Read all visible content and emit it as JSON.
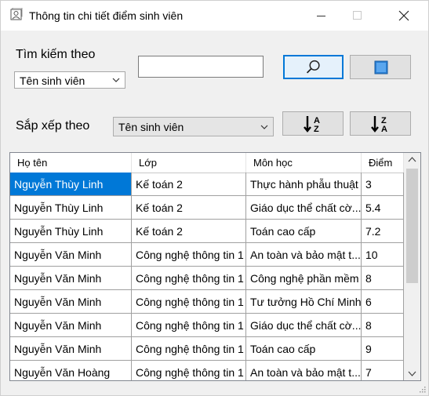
{
  "window": {
    "title": "Thông tin chi tiết điểm sinh viên",
    "icon": "student-info-icon"
  },
  "search": {
    "label": "Tìm kiếm theo",
    "field_selected": "Tên sinh viên",
    "query_value": "",
    "search_icon": "search-icon",
    "refresh_icon": "refresh-icon"
  },
  "sort": {
    "label": "Sắp xếp theo",
    "field_selected": "Tên sinh viên",
    "asc_icon": "sort-ascending-icon",
    "desc_icon": "sort-descending-icon"
  },
  "table": {
    "columns": [
      "Họ tên",
      "Lớp",
      "Môn học",
      "Điểm"
    ],
    "rows": [
      [
        "Nguyễn Thùy Linh",
        "Kế toán 2",
        "Thực hành phẫu thuật",
        "3"
      ],
      [
        "Nguyễn Thùy Linh",
        "Kế toán 2",
        "Giáo dục thể chất cờ...",
        "5.4"
      ],
      [
        "Nguyễn Thùy Linh",
        "Kế toán 2",
        "Toán cao cấp",
        "7.2"
      ],
      [
        "Nguyễn Văn Minh",
        "Công nghệ thông tin 1",
        "An toàn và bảo mật t...",
        "10"
      ],
      [
        "Nguyễn Văn Minh",
        "Công nghệ thông tin 1",
        "Công nghệ phần mềm",
        "8"
      ],
      [
        "Nguyễn Văn Minh",
        "Công nghệ thông tin 1",
        "Tư tưởng Hồ Chí Minh",
        "6"
      ],
      [
        "Nguyễn Văn Minh",
        "Công nghệ thông tin 1",
        "Giáo dục thể chất cờ...",
        "8"
      ],
      [
        "Nguyễn Văn Minh",
        "Công nghệ thông tin 1",
        "Toán cao cấp",
        "9"
      ],
      [
        "Nguyễn Văn Hoàng",
        "Công nghệ thông tin 1",
        "An toàn và bảo mật t...",
        "7"
      ]
    ]
  },
  "colors": {
    "selection": "#0078d7",
    "title_bar": "#ffffff",
    "window_bg": "#f0f0f0"
  }
}
